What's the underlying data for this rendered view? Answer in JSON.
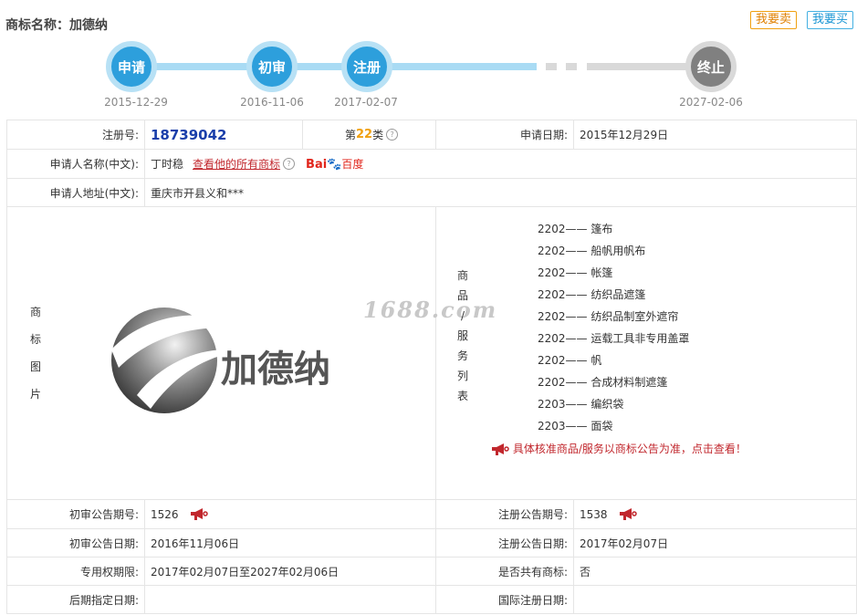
{
  "header": {
    "title": "商标名称：加德纳",
    "sell_label": "我要卖",
    "buy_label": "我要买"
  },
  "timeline": [
    {
      "label": "申请",
      "date": "2015-12-29"
    },
    {
      "label": "初审",
      "date": "2016-11-06"
    },
    {
      "label": "注册",
      "date": "2017-02-07"
    },
    {
      "label": "终止",
      "date": "2027-02-06"
    }
  ],
  "info": {
    "reg_no_label": "注册号:",
    "reg_no": "18739042",
    "class_prefix": "第",
    "class_num": "22",
    "class_suffix": "类",
    "help_glyph": "?",
    "apply_date_label": "申请日期:",
    "apply_date": "2015年12月29日",
    "applicant_label": "申请人名称(中文):",
    "applicant": "丁时稳",
    "view_all_link": "查看他的所有商标",
    "baidu_b1": "Bai",
    "baidu_b2": "百度",
    "address_label": "申请人地址(中文):",
    "address": "重庆市开县义和***",
    "image_label": "商标图片",
    "trademark_text": "加德纳",
    "watermark": "1688.com",
    "services_label": "商品/服务列表",
    "notice": "具体核准商品/服务以商标公告为准，点击查看！"
  },
  "services": [
    {
      "code": "2202——",
      "name": "篷布"
    },
    {
      "code": "2202——",
      "name": "船帆用帆布"
    },
    {
      "code": "2202——",
      "name": "帐篷"
    },
    {
      "code": "2202——",
      "name": "纺织品遮篷"
    },
    {
      "code": "2202——",
      "name": "纺织品制室外遮帘"
    },
    {
      "code": "2202——",
      "name": "运载工具非专用盖罩"
    },
    {
      "code": "2202——",
      "name": "帆"
    },
    {
      "code": "2202——",
      "name": "合成材料制遮篷"
    },
    {
      "code": "2203——",
      "name": "编织袋"
    },
    {
      "code": "2203——",
      "name": "面袋"
    }
  ],
  "details": {
    "prelim_no_label": "初审公告期号:",
    "prelim_no": "1526",
    "reg_pub_no_label": "注册公告期号:",
    "reg_pub_no": "1538",
    "prelim_date_label": "初审公告日期:",
    "prelim_date": "2016年11月06日",
    "reg_pub_date_label": "注册公告日期:",
    "reg_pub_date": "2017年02月07日",
    "exclusive_label": "专用权期限:",
    "exclusive": "2017年02月07日至2027年02月06日",
    "shared_label": "是否共有商标:",
    "shared": "否",
    "later_label": "后期指定日期:",
    "later": "",
    "intl_label": "国际注册日期:",
    "intl": ""
  },
  "colors": {
    "accent_blue": "#2d9fdc",
    "track_blue": "#a9dbf4",
    "link_red": "#c1272d",
    "reg_no_blue": "#1a3faa",
    "class_orange": "#f0a010"
  }
}
